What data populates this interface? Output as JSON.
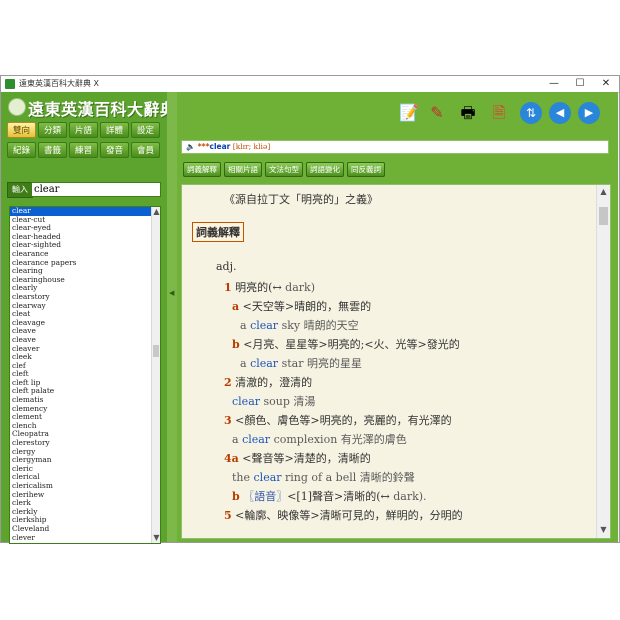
{
  "window": {
    "title": "遠東英漢百科大辭典 X",
    "controls": {
      "minimize": "—",
      "maximize": "☐",
      "close": "✕"
    }
  },
  "logo": {
    "text": "遠東英漢百科大辭典"
  },
  "nav": {
    "row1": [
      "雙向",
      "分類",
      "片語",
      "詳體",
      "設定"
    ],
    "row2": [
      "紀錄",
      "書籤",
      "練習",
      "發音",
      "會員"
    ],
    "active": "雙向"
  },
  "search": {
    "label": "輸入",
    "value": "clear"
  },
  "wordlist": [
    "clear",
    "clear-cut",
    "clear-eyed",
    "clear-headed",
    "clear-sighted",
    "clearance",
    "clearance papers",
    "clearing",
    "clearinghouse",
    "clearly",
    "clearstory",
    "clearway",
    "cleat",
    "cleavage",
    "cleave",
    "cleave",
    "cleaver",
    "cleek",
    "clef",
    "cleft",
    "cleft lip",
    "cleft palate",
    "clematis",
    "clemency",
    "clement",
    "clench",
    "Cleopatra",
    "clerestory",
    "clergy",
    "clergyman",
    "cleric",
    "clerical",
    "clericalism",
    "clerihew",
    "clerk",
    "clerkly",
    "clerkship",
    "Cleveland",
    "clever"
  ],
  "toolbar": {
    "icons": [
      "notepad-icon",
      "pen-icon",
      "print-icon",
      "add-note-icon",
      "sync-icon",
      "back-icon",
      "forward-icon"
    ]
  },
  "entry": {
    "prefix": "***",
    "headword": "clear",
    "pron": "[klɪr; kliə]"
  },
  "tabs": [
    "詞義解釋",
    "相關片語",
    "文法句型",
    "詞語變化",
    "同反義詞"
  ],
  "content": {
    "etymology": "《源自拉丁文「明亮的」之義》",
    "section_title": "詞義解釋",
    "pos": "adj.",
    "senses": [
      {
        "num": "1",
        "text": "明亮的(",
        "ref": "dark)"
      },
      {
        "num": "a",
        "text": "<天空等>晴朗的，無雲的"
      },
      {
        "example_pre": "a ",
        "example_hl": "clear",
        "example_post": " sky 晴朗的天空"
      },
      {
        "num": "b",
        "text": "<月亮、星星等>明亮的;<火、光等>發光的"
      },
      {
        "example_pre": "a ",
        "example_hl": "clear",
        "example_post": " star 明亮的星星"
      },
      {
        "num": "2",
        "text": "清澈的，澄清的"
      },
      {
        "example_pre": "",
        "example_hl": "clear",
        "example_post": " soup 清湯"
      },
      {
        "num": "3",
        "text": "<顏色、膚色等>明亮的，亮麗的，有光澤的"
      },
      {
        "example_pre": "a ",
        "example_hl": "clear",
        "example_post": " complexion 有光澤的膚色"
      },
      {
        "num": "4a",
        "text": "<聲音等>清楚的，清晰的"
      },
      {
        "example_pre": "the ",
        "example_hl": "clear",
        "example_post": " ring of a bell 清晰的鈴聲"
      },
      {
        "num": "b",
        "label": "〖語音〗",
        "text": "<[1]聲音>清晰的(",
        "ref": "dark)."
      },
      {
        "num": "5",
        "text": "<輪廓、映像等>清晰可見的，鮮明的，分明的"
      }
    ]
  },
  "colors": {
    "panel_green": "#5da42e",
    "accent_orange": "#c25400",
    "highlight_blue": "#1b55b5"
  }
}
